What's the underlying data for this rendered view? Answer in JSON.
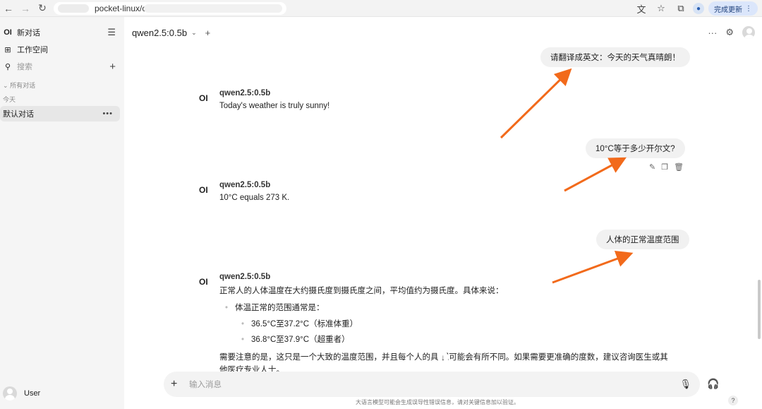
{
  "browser": {
    "url": "pocket-linux/c",
    "update_label": "完成更新",
    "icons": [
      "back-icon",
      "forward-icon",
      "reload-icon",
      "translate-icon",
      "star-icon",
      "extensions-icon",
      "profile-icon",
      "kebab-icon"
    ]
  },
  "sidebar": {
    "logo": "OI",
    "new_chat": "新对话",
    "workspace": "工作空间",
    "search_placeholder": "搜索",
    "section_all": "所有对话",
    "section_today": "今天",
    "chat_title": "默认对话",
    "user_name": "User"
  },
  "header": {
    "model": "qwen2.5:0.5b"
  },
  "messages": {
    "user1": "请翻译成英文：今天的天气真晴朗！",
    "asst1_name": "qwen2.5:0.5b",
    "asst1_text": "Today's weather is truly sunny!",
    "user2": "10°C等于多少开尔文?",
    "asst2_name": "qwen2.5:0.5b",
    "asst2_text": "10°C equals 273 K.",
    "user3": "人体的正常温度范围",
    "asst3_name": "qwen2.5:0.5b",
    "asst3_intro": "正常人的人体温度在大约摄氏度到摄氏度之间，平均值约为摄氏度。具体来说：",
    "asst3_bullet": "体温正常的范围通常是：",
    "asst3_sub1": "36.5°C至37.2°C（标准体重）",
    "asst3_sub2": "36.8°C至37.9°C（超重者）",
    "asst3_outro": "需要注意的是，这只是一个大致的温度范围，并且每个人的具 况可能会有所不同。如果需要更准确的度数，建议咨询医生或其他医疗专业人士。"
  },
  "composer": {
    "placeholder": "输入消息",
    "disclaimer": "大语言模型可能会生成误导性错误信息，请对关键信息加以验证。",
    "help": "?"
  },
  "colors": {
    "arrow": "#f26a1b",
    "sidebar_bg": "#f5f5f5",
    "bubble_bg": "#f1f1f1"
  }
}
